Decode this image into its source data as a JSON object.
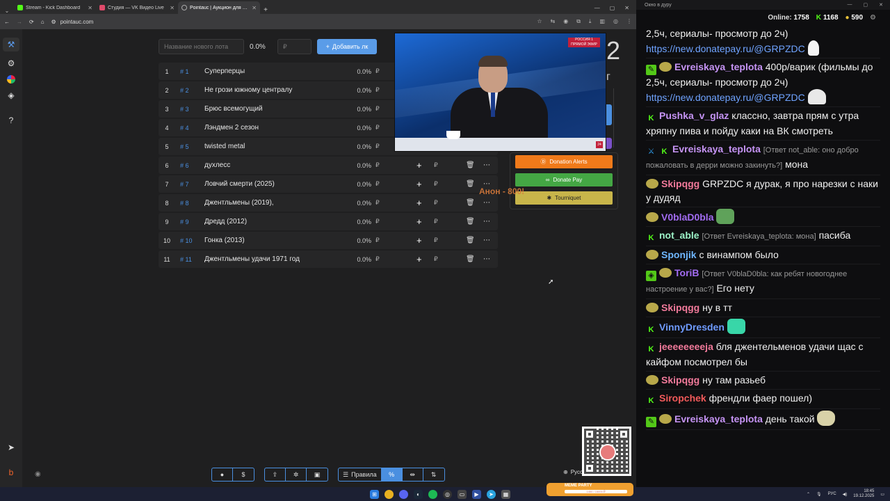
{
  "browser": {
    "tabs": [
      {
        "title": "Stream - Kick Dashboard",
        "icon_color": "#53fc18",
        "active": false
      },
      {
        "title": "Студия — VK Видео Live",
        "icon_color": "#e04a6a",
        "active": false
      },
      {
        "title": "Pointauc | Аукцион для стрима",
        "icon_color": "#888888",
        "active": true
      }
    ],
    "url": "pointauc.com",
    "window_controls": [
      "—",
      "▢",
      "✕"
    ]
  },
  "controls": {
    "lot_name_placeholder": "Название нового лота",
    "total_percent": "0.0%",
    "amount_placeholder": "₽",
    "add_button": "Добавить лк"
  },
  "lots": [
    {
      "num": "1",
      "id": "1",
      "name": "Суперперцы",
      "pct": "0.0%",
      "currency": "₽"
    },
    {
      "num": "2",
      "id": "2",
      "name": "Не грози южному централу",
      "pct": "0.0%",
      "currency": "₽"
    },
    {
      "num": "3",
      "id": "3",
      "name": "Брюс всемогущий",
      "pct": "0.0%",
      "currency": "₽"
    },
    {
      "num": "4",
      "id": "4",
      "name": "Лэндмен 2 сезон",
      "pct": "0.0%",
      "currency": "₽"
    },
    {
      "num": "5",
      "id": "5",
      "name": "twisted metal",
      "pct": "0.0%",
      "currency": "₽"
    },
    {
      "num": "6",
      "id": "6",
      "name": "духлесс",
      "pct": "0.0%",
      "currency": "₽"
    },
    {
      "num": "7",
      "id": "7",
      "name": "Ловчий смерти (2025)",
      "pct": "0.0%",
      "currency": "₽"
    },
    {
      "num": "8",
      "id": "8",
      "name": "Джентльмены (2019),",
      "pct": "0.0%",
      "currency": "₽"
    },
    {
      "num": "9",
      "id": "9",
      "name": "Дредд (2012)",
      "pct": "0.0%",
      "currency": "₽"
    },
    {
      "num": "10",
      "id": "10",
      "name": "Гонка (2013)",
      "pct": "0.0%",
      "currency": "₽"
    },
    {
      "num": "11",
      "id": "11",
      "name": "Джентльмены удачи 1971 год",
      "pct": "0.0%",
      "currency": "₽"
    }
  ],
  "side": {
    "big_digit": "2"
  },
  "video": {
    "channel_logo": "РОССИЯ 1 ПРЯМОЙ ЭФИР",
    "badge": "24"
  },
  "donations": {
    "alerts": "Donation Alerts",
    "pay": "Donate Pay",
    "tourniquet": "Tourniquet"
  },
  "overlay_text": "Анон - 800!",
  "toolbar": {
    "rules_label": "Правила",
    "percent_label": "%",
    "currency_label": "$"
  },
  "language": "Русский",
  "meme_party": {
    "label": "MEME PARTY",
    "progress_text": "1450 / 15000 ₽"
  },
  "chat": {
    "window_title": "Окно в дуру",
    "online_label": "Online:",
    "online_value": "1758",
    "kick_count": "1168",
    "coin_count": "590",
    "messages": [
      {
        "badges": [],
        "user": "",
        "user_color": "#f0f0f0",
        "reply": "",
        "text": "2,5ч, сериалы- просмотр до 2ч)",
        "link": "https://new.donatepay.ru/@GRPZDC",
        "emote": "goose"
      },
      {
        "badges": [
          "pen",
          "avatar"
        ],
        "user": "Evreiskaya_teplota",
        "user_color": "#c694f5",
        "reply": "",
        "text": "400р/варик (фильмы до 2,5ч, сериалы- просмотр до 2ч)",
        "link": "https://new.donatepay.ru/@GRPZDC",
        "emote": "ghost"
      },
      {
        "badges": [
          "kick"
        ],
        "user": "Pushka_v_glaz",
        "user_color": "#c694f5",
        "reply": "",
        "text": "классно, завтра прям с утра хряпну пива и пойду каки на ВК смотреть",
        "link": "",
        "emote": ""
      },
      {
        "badges": [
          "sword",
          "kick"
        ],
        "user": "Evreiskaya_teplota",
        "user_color": "#c694f5",
        "reply": "[Ответ not_able: оно добро пожаловать в дерри можно закинуть?]",
        "text": "мона",
        "link": "",
        "emote": ""
      },
      {
        "badges": [
          "avatar"
        ],
        "user": "Skipqgg",
        "user_color": "#f27a9b",
        "reply": "",
        "text": "GRPZDC я дурак, я про нарезки с наки у дудяд",
        "link": "",
        "emote": ""
      },
      {
        "badges": [
          "avatar"
        ],
        "user": "V0blaD0bla",
        "user_color": "#a26cf2",
        "reply": "",
        "text": "",
        "link": "",
        "emote": "frog"
      },
      {
        "badges": [
          "kick"
        ],
        "user": "not_able",
        "user_color": "#9cf2c7",
        "reply": "[Ответ Evreiskaya_teplota: мона]",
        "text": "пасиба",
        "link": "",
        "emote": ""
      },
      {
        "badges": [
          "avatar"
        ],
        "user": "Sponjik",
        "user_color": "#6fb7ff",
        "reply": "",
        "text": "с винампом было",
        "link": "",
        "emote": ""
      },
      {
        "badges": [
          "shield",
          "avatar"
        ],
        "user": "ToriB",
        "user_color": "#a26cf2",
        "reply": "[Ответ V0blaD0bla: как ребят новогоднее настроение у вас?]",
        "text": "Его нету",
        "link": "",
        "emote": ""
      },
      {
        "badges": [
          "avatar"
        ],
        "user": "Skipqgg",
        "user_color": "#f27a9b",
        "reply": "",
        "text": "ну в тт",
        "link": "",
        "emote": ""
      },
      {
        "badges": [
          "kick"
        ],
        "user": "VinnyDresden",
        "user_color": "#6f9bff",
        "reply": "",
        "text": "",
        "link": "",
        "emote": "cat"
      },
      {
        "badges": [
          "kick"
        ],
        "user": "jeeeeeeeeja",
        "user_color": "#f27a9b",
        "reply": "",
        "text": "бля джентельменов удачи щас с кайфом посмотрел бы",
        "link": "",
        "emote": ""
      },
      {
        "badges": [
          "avatar"
        ],
        "user": "Skipqgg",
        "user_color": "#f27a9b",
        "reply": "",
        "text": "ну там разьеб",
        "link": "",
        "emote": ""
      },
      {
        "badges": [
          "kick"
        ],
        "user": "Siropchek",
        "user_color": "#f25a5a",
        "reply": "",
        "text": "френдли фаер пошел)",
        "link": "",
        "emote": ""
      },
      {
        "badges": [
          "pen",
          "avatar"
        ],
        "user": "Evreiskaya_teplota",
        "user_color": "#c694f5",
        "reply": "",
        "text": "день такой",
        "link": "",
        "emote": "hat"
      }
    ]
  },
  "taskbar": {
    "lang": "РУС",
    "time": "18:45",
    "date": "19.12.2025"
  }
}
